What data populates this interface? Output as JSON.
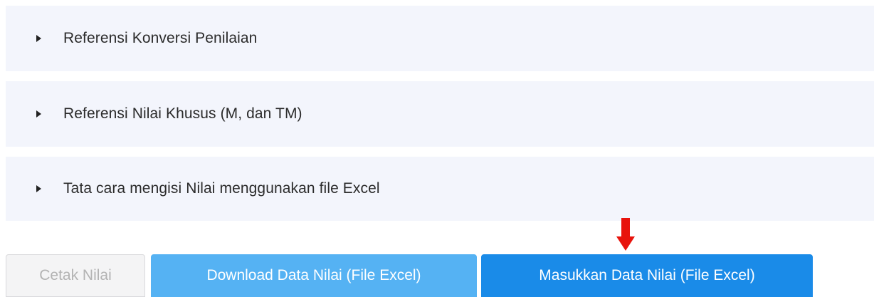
{
  "accordion": {
    "items": [
      {
        "label": "Referensi Konversi Penilaian",
        "icon": "caret-right-icon"
      },
      {
        "label": "Referensi Nilai Khusus (M, dan TM)",
        "icon": "caret-right-icon"
      },
      {
        "label": "Tata cara mengisi Nilai menggunakan file Excel",
        "icon": "caret-right-icon"
      }
    ]
  },
  "annotation": {
    "icon": "red-down-arrow-icon",
    "color": "#e8130c"
  },
  "actions": {
    "print_label": "Cetak Nilai",
    "download_label": "Download Data Nilai (File Excel)",
    "upload_label": "Masukkan Data Nilai (File Excel)"
  },
  "colors": {
    "panel_bg": "#f3f5fc",
    "download_button": "#55b2f3",
    "upload_button": "#1a8be8",
    "disabled_text": "#b3b3b3"
  }
}
